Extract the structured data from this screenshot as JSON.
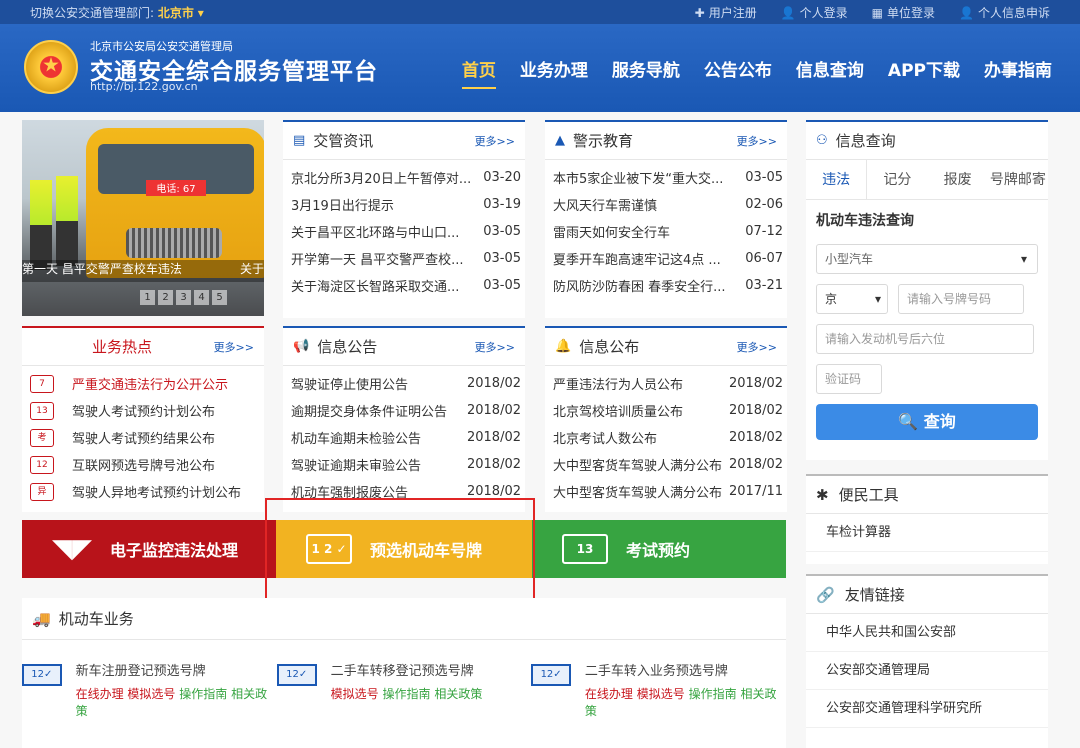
{
  "topbar": {
    "switch_label": "切换公安交通管理部门:",
    "city": "北京市",
    "links": [
      "用户注册",
      "个人登录",
      "单位登录",
      "个人信息申诉"
    ]
  },
  "header": {
    "agency": "北京市公安局公安交通管理局",
    "title": "交通安全综合服务管理平台",
    "url": "http://bj.122.gov.cn",
    "nav": [
      "首页",
      "业务办理",
      "服务导航",
      "公告公布",
      "信息查询",
      "APP下载",
      "办事指南"
    ]
  },
  "slideshow": {
    "caption": "第一天 昌平交警严查校车违法",
    "caption_right": "关于",
    "sign": "电话: 67",
    "dots": [
      "1",
      "2",
      "3",
      "4",
      "5"
    ]
  },
  "news": {
    "title": "交管资讯",
    "more": "更多>>",
    "items": [
      {
        "t": "京北分所3月20日上午暂停对...",
        "d": "03-20"
      },
      {
        "t": "3月19日出行提示",
        "d": "03-19"
      },
      {
        "t": "关于昌平区北环路与中山口...",
        "d": "03-05"
      },
      {
        "t": "开学第一天 昌平交警严查校...",
        "d": "03-05"
      },
      {
        "t": "关于海淀区长智路采取交通...",
        "d": "03-05"
      }
    ]
  },
  "warning": {
    "title": "警示教育",
    "more": "更多>>",
    "items": [
      {
        "t": "本市5家企业被下发“重大交...",
        "d": "03-05"
      },
      {
        "t": "大风天行车需谨慎",
        "d": "02-06"
      },
      {
        "t": "雷雨天如何安全行车",
        "d": "07-12"
      },
      {
        "t": "夏季开车跑高速牢记这4点 ...",
        "d": "06-07"
      },
      {
        "t": "防风防沙防春困 春季安全行...",
        "d": "03-21"
      }
    ]
  },
  "hot": {
    "title": "业务热点",
    "more": "更多>>",
    "items": [
      {
        "t": "严重交通违法行为公开公示",
        "i": "7"
      },
      {
        "t": "驾驶人考试预约计划公布",
        "i": "13"
      },
      {
        "t": "驾驶人考试预约结果公布",
        "i": "考"
      },
      {
        "t": "互联网预选号牌号池公布",
        "i": "12"
      },
      {
        "t": "驾驶人异地考试预约计划公布",
        "i": "异"
      }
    ]
  },
  "notice": {
    "title": "信息公告",
    "more": "更多>>",
    "items": [
      {
        "t": "驾驶证停止使用公告",
        "d": "2018/02"
      },
      {
        "t": "逾期提交身体条件证明公告",
        "d": "2018/02"
      },
      {
        "t": "机动车逾期未检验公告",
        "d": "2018/02"
      },
      {
        "t": "驾驶证逾期未审验公告",
        "d": "2018/02"
      },
      {
        "t": "机动车强制报废公告",
        "d": "2018/02"
      }
    ]
  },
  "publish": {
    "title": "信息公布",
    "more": "更多>>",
    "items": [
      {
        "t": "严重违法行为人员公布",
        "d": "2018/02"
      },
      {
        "t": "北京驾校培训质量公布",
        "d": "2018/02"
      },
      {
        "t": "北京考试人数公布",
        "d": "2018/02"
      },
      {
        "t": "大中型客货车驾驶人满分公布",
        "d": "2018/02"
      },
      {
        "t": "大中型客货车驾驶人满分公布",
        "d": "2017/11"
      }
    ]
  },
  "banners": {
    "red": "电子监控违法处理",
    "yellow": "预选机动车号牌",
    "yellow_icon": "1 2 ✓",
    "green": "考试预约",
    "green_icon": "13"
  },
  "vehicle": {
    "title": "机动车业务",
    "items": [
      {
        "name": "新车注册登记预选号牌",
        "badge": "12✓",
        "links": [
          "在线办理",
          "模拟选号",
          "操作指南",
          "相关政策"
        ]
      },
      {
        "name": "二手车转移登记预选号牌",
        "badge": "12✓",
        "links": [
          "模拟选号",
          "操作指南",
          "相关政策"
        ]
      },
      {
        "name": "二手车转入业务预选号牌",
        "badge": "12✓",
        "links": [
          "在线办理",
          "模拟选号",
          "操作指南",
          "相关政策"
        ]
      }
    ]
  },
  "query": {
    "title": "信息查询",
    "tabs": [
      "违法",
      "记分",
      "报废",
      "号牌邮寄"
    ],
    "form_title": "机动车违法查询",
    "vehicle_type": "小型汽车",
    "province": "京",
    "plate_placeholder": "请输入号牌号码",
    "engine_placeholder": "请输入发动机号后六位",
    "captcha_placeholder": "验证码",
    "button": "查询"
  },
  "tools": {
    "title": "便民工具",
    "items": [
      "车检计算器"
    ]
  },
  "friend": {
    "title": "友情链接",
    "items": [
      "中华人民共和国公安部",
      "公安部交通管理局",
      "公安部交通管理科学研究所"
    ]
  },
  "colors": {
    "primary": "#1a58b4",
    "red": "#b8131a",
    "yellow": "#f2b321",
    "green": "#37a441",
    "highlight": "#e12525"
  }
}
